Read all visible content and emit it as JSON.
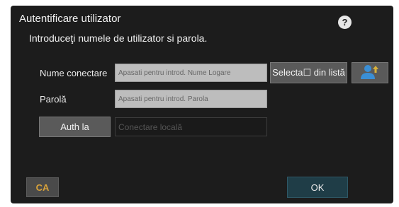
{
  "dialog": {
    "title": "Autentificare utilizator",
    "subtitle": "Introduceţi numele de utilizator si parola.",
    "help_icon_text": "?"
  },
  "form": {
    "username_label": "Nume conectare",
    "username_placeholder": "Apasati pentru introd. Nume Logare",
    "select_from_list_label": "Selecta☐ din listă",
    "password_label": "Parolă",
    "password_placeholder": "Apasati pentru introd. Parola",
    "auth_button_label": "Auth la",
    "auth_destination_value": "Conectare locală"
  },
  "footer": {
    "ca_label": "CA",
    "ok_label": "OK"
  },
  "icons": {
    "user_select_icon": "user-select-icon",
    "help_icon": "help-icon"
  },
  "colors": {
    "dialog_bg": "#1c1c1c",
    "ca_accent": "#d8a23a",
    "ok_bg": "#1f3d47",
    "user_icon_blue": "#3a8fd6"
  }
}
